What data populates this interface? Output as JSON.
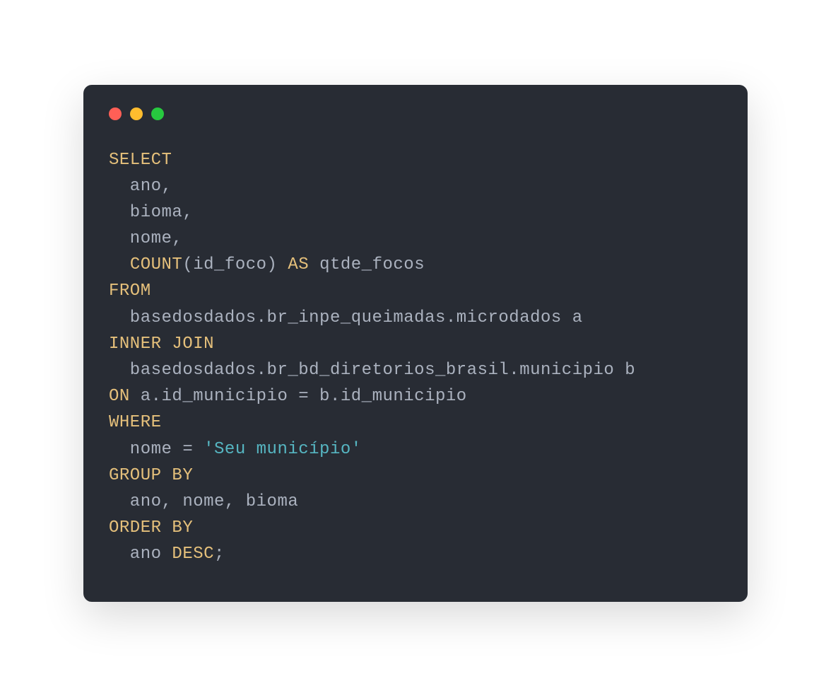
{
  "code": {
    "line1_select": "SELECT",
    "line2": "  ano,",
    "line3": "  bioma,",
    "line4": "  nome,",
    "line5_indent": "  ",
    "line5_count": "COUNT",
    "line5_mid": "(id_foco) ",
    "line5_as": "AS",
    "line5_end": " qtde_focos",
    "line6_from": "FROM",
    "line7": "  basedosdados.br_inpe_queimadas.microdados a",
    "line8_innerjoin": "INNER JOIN",
    "line9": "  basedosdados.br_bd_diretorios_brasil.municipio b",
    "line10_on": "ON",
    "line10_rest": " a.id_municipio = b.id_municipio",
    "line11_where": "WHERE",
    "line12_indent": "  nome = ",
    "line12_string": "'Seu município'",
    "line13_groupby": "GROUP BY",
    "line14": "  ano, nome, bioma",
    "line15_orderby": "ORDER BY",
    "line16_indent": "  ano ",
    "line16_desc": "DESC",
    "line16_semi": ";"
  }
}
